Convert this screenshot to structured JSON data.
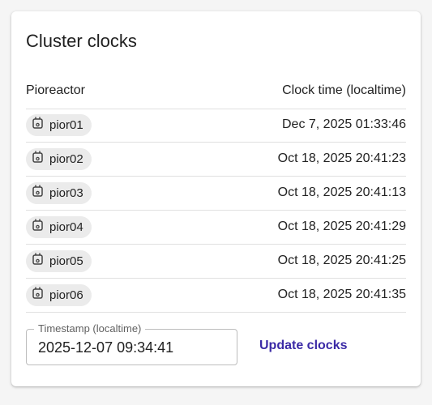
{
  "card": {
    "title": "Cluster clocks"
  },
  "table": {
    "headers": {
      "unit": "Pioreactor",
      "clock": "Clock time (localtime)"
    },
    "rows": [
      {
        "unit": "pior01",
        "clock": "Dec 7, 2025 01:33:46"
      },
      {
        "unit": "pior02",
        "clock": "Oct 18, 2025 20:41:23"
      },
      {
        "unit": "pior03",
        "clock": "Oct 18, 2025 20:41:13"
      },
      {
        "unit": "pior04",
        "clock": "Oct 18, 2025 20:41:29"
      },
      {
        "unit": "pior05",
        "clock": "Oct 18, 2025 20:41:25"
      },
      {
        "unit": "pior06",
        "clock": "Oct 18, 2025 20:41:35"
      }
    ]
  },
  "timestamp_field": {
    "label": "Timestamp (localtime)",
    "value": "2025-12-07 09:34:41"
  },
  "actions": {
    "update_label": "Update clocks"
  },
  "colors": {
    "accent": "#3b2aa6",
    "chip_bg": "#ebebeb",
    "divider": "#e0e0e0"
  },
  "icons": {
    "unit_icon": "pioreactor-unit-icon"
  }
}
